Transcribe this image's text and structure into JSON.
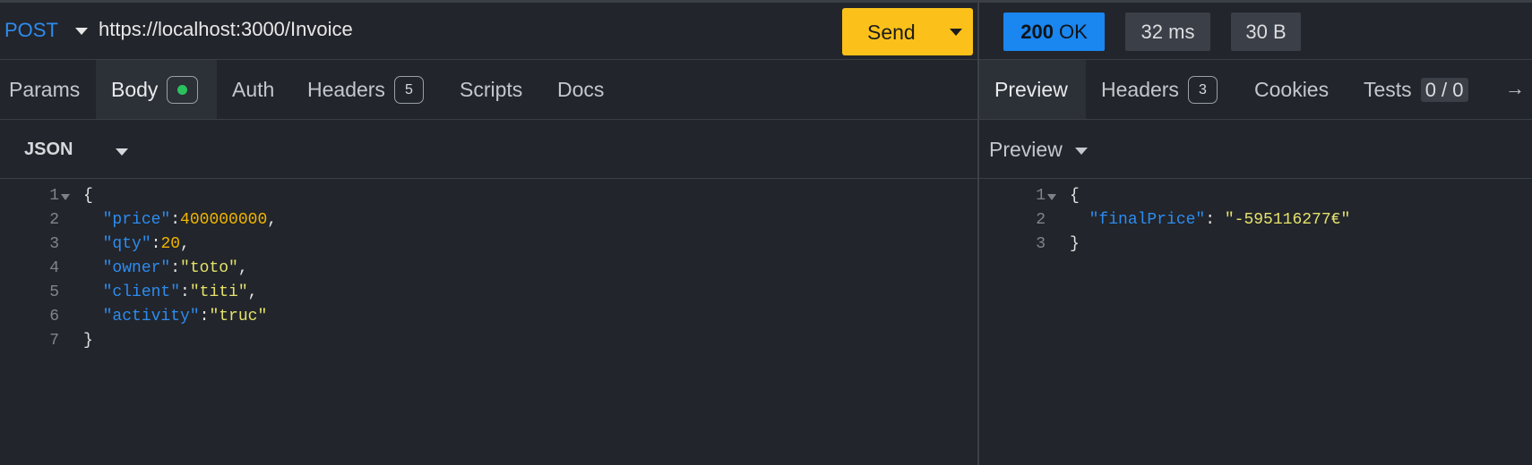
{
  "request": {
    "method": "POST",
    "url": "https://localhost:3000/Invoice",
    "send_label": "Send"
  },
  "request_tabs": {
    "params": "Params",
    "body": "Body",
    "auth": "Auth",
    "headers": "Headers",
    "headers_count": "5",
    "scripts": "Scripts",
    "docs": "Docs"
  },
  "body_format": "JSON",
  "request_body_lines": [
    {
      "num": "1",
      "text": "{"
    },
    {
      "num": "2",
      "key": "\"price\"",
      "sep": ":",
      "value": "400000000",
      "tail": ","
    },
    {
      "num": "3",
      "key": "\"qty\"",
      "sep": ":",
      "value": "20",
      "tail": ","
    },
    {
      "num": "4",
      "key": "\"owner\"",
      "sep": ":",
      "value": "\"toto\"",
      "tail": ","
    },
    {
      "num": "5",
      "key": "\"client\"",
      "sep": ":",
      "value": "\"titi\"",
      "tail": ","
    },
    {
      "num": "6",
      "key": "\"activity\"",
      "sep": ":",
      "value": "\"truc\"",
      "tail": ""
    },
    {
      "num": "7",
      "text": "}"
    }
  ],
  "response": {
    "status_code": "200",
    "status_text": "OK",
    "time": "32 ms",
    "size": "30 B"
  },
  "response_tabs": {
    "preview": "Preview",
    "headers": "Headers",
    "headers_count": "3",
    "cookies": "Cookies",
    "tests": "Tests",
    "tests_count": "0 / 0",
    "arrow": "→"
  },
  "preview_mode": "Preview",
  "response_body_lines": [
    {
      "num": "1",
      "text": "{"
    },
    {
      "num": "2",
      "key": "\"finalPrice\"",
      "sep": ": ",
      "value": "\"-595116277€\"",
      "tail": ""
    },
    {
      "num": "3",
      "text": "}"
    }
  ],
  "colors": {
    "accent_blue": "#2d8cf0",
    "send_yellow": "#fbc11a",
    "status_ok": "#1a86f0",
    "body_dot": "#2bc25e",
    "number": "#f0b400",
    "string": "#e5e26b",
    "background": "#22252b"
  }
}
